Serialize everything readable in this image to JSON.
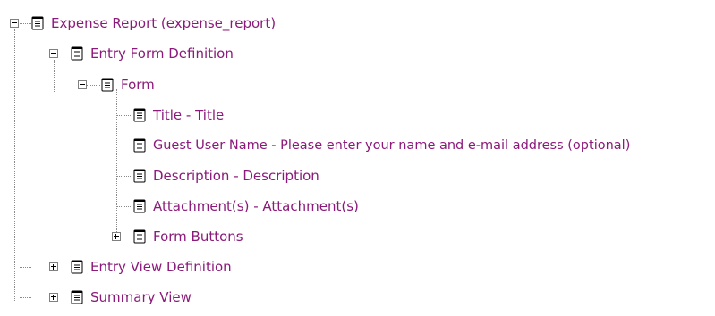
{
  "tree": {
    "root": {
      "label": "Expense Report (expense_report)",
      "icon": "document-icon"
    },
    "entry_form": {
      "label": "Entry Form Definition",
      "icon": "document-icon"
    },
    "form": {
      "label": "Form",
      "icon": "document-icon"
    },
    "fields": [
      {
        "label": "Title - Title",
        "icon": "document-icon"
      },
      {
        "label": "Guest User Name - Please enter your name and e-mail address (optional)",
        "icon": "document-icon"
      },
      {
        "label": "Description - Description",
        "icon": "document-icon"
      },
      {
        "label": "Attachment(s) - Attachment(s)",
        "icon": "document-icon"
      },
      {
        "label": "Form Buttons",
        "icon": "document-icon"
      }
    ],
    "entry_view": {
      "label": "Entry View Definition",
      "icon": "document-icon"
    },
    "summary_view": {
      "label": "Summary View",
      "icon": "document-icon"
    }
  },
  "colors": {
    "label": "#8b1a7a",
    "connector": "#8a8a8a"
  }
}
